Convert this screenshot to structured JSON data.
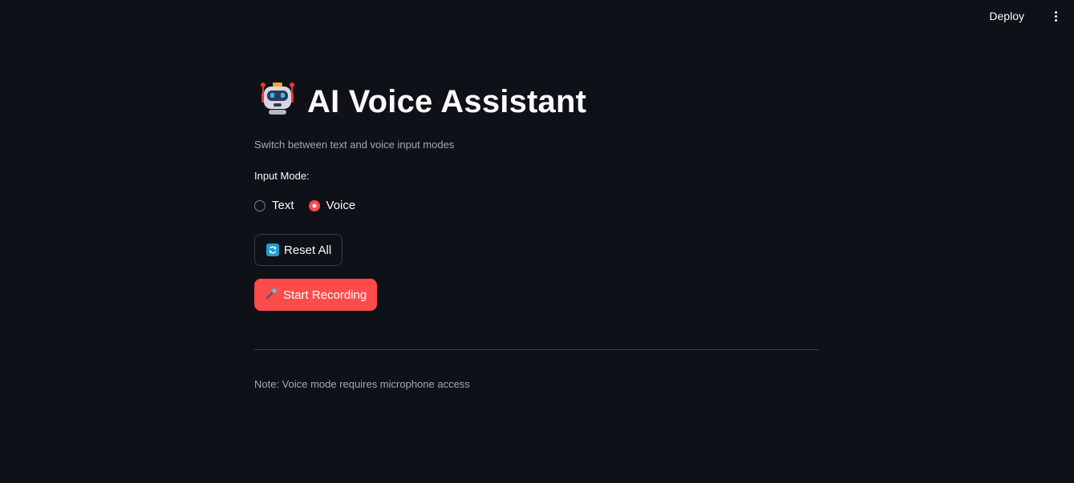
{
  "header": {
    "deploy_label": "Deploy",
    "menu_icon": "kebab-menu-icon"
  },
  "main": {
    "title_icon": "robot-icon",
    "title": "AI Voice Assistant",
    "subtitle": "Switch between text and voice input modes",
    "input_mode": {
      "label": "Input Mode:",
      "options": [
        {
          "label": "Text",
          "checked": false
        },
        {
          "label": "Voice",
          "checked": true
        }
      ]
    },
    "reset_button": {
      "icon": "refresh-icon",
      "label": "Reset All"
    },
    "record_button": {
      "icon": "microphone-icon",
      "label": "Start Recording"
    },
    "note": "Note: Voice mode requires microphone access"
  },
  "colors": {
    "background": "#0e1117",
    "accent": "#ff4b4b",
    "text": "#fafafa",
    "muted": "#a3a8b8"
  }
}
